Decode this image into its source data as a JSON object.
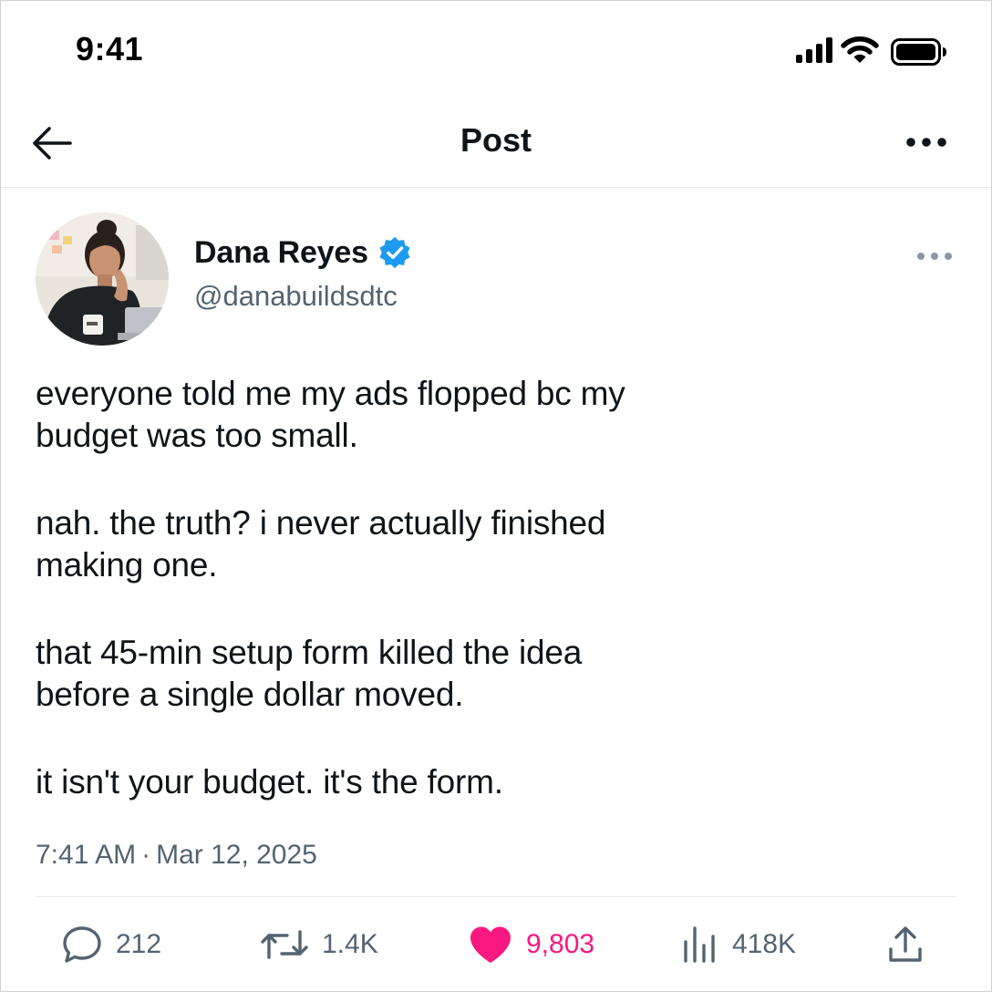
{
  "status_bar": {
    "time": "9:41",
    "icons": [
      "signal-icon",
      "wifi-icon",
      "battery-icon"
    ]
  },
  "header": {
    "back_icon": "arrow-left-icon",
    "title": "Post",
    "more_icon": "more-horizontal-icon"
  },
  "post": {
    "author": {
      "name": "Dana Reyes",
      "handle": "@danabuildsdtc",
      "verified": true,
      "verified_color": "#1d9bf0"
    },
    "paragraphs": [
      "everyone told me my ads flopped bc my\nbudget was too small.",
      "nah. the truth? i never actually finished\nmaking one.",
      "that 45-min setup form killed the idea\nbefore a single dollar moved.",
      "it isn't your budget. it's the form."
    ],
    "time": "7:41 AM",
    "separator": "·",
    "date": "Mar 12, 2025"
  },
  "actions": {
    "replies": "212",
    "reposts": "1.4K",
    "likes": "9,803",
    "liked": true,
    "like_color": "#f91880",
    "views": "418K"
  },
  "colors": {
    "text_primary": "#0f1419",
    "text_secondary": "#536471",
    "divider": "#e6e8ea"
  }
}
